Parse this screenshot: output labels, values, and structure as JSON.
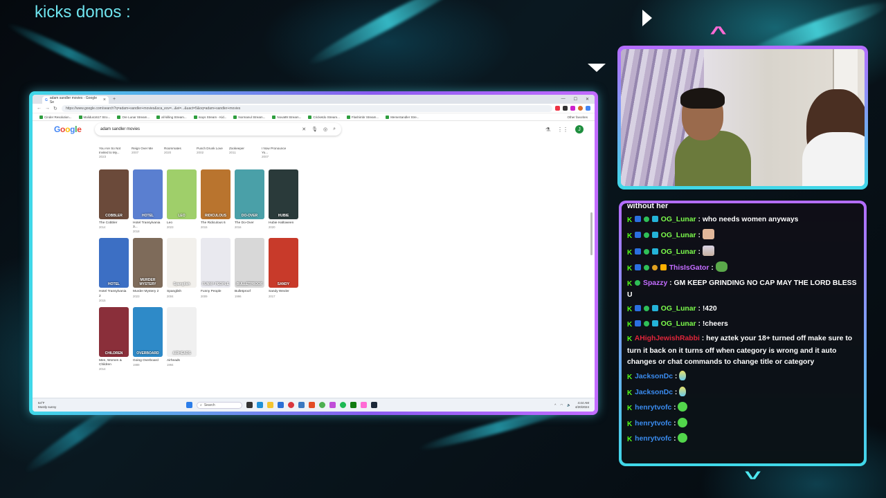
{
  "overlay": {
    "title": "kicks donos :"
  },
  "browser": {
    "tab_title": "adam sandler movies - Google Se",
    "url": "https://www.google.com/search?q=adam+sandler+movies&sca_esv=...&ei=...&uact=5&oq=adam+sandler+movies",
    "bookmarks": [
      "Cinder Resolution...",
      "Malidus1617 Stro...",
      "Ore Lunar Stream...",
      "all killing Stream...",
      "mays Stream - Kid...",
      "Normanul Stream...",
      "Nova89 Stream...",
      "Cricketdo Stream...",
      "Flashimbr Stream...",
      "MemeSandler Stre..."
    ],
    "bookmarks_right": "Other favorites",
    "search_query": "adam sandler movies",
    "avatar_letter": "J",
    "previous_row": [
      {
        "title": "You Are So Not Invited to My...",
        "year": "2023"
      },
      {
        "title": "Reign Over Me",
        "year": "2007"
      },
      {
        "title": "Roommates",
        "year": "2020"
      },
      {
        "title": "Punch Drunk Love",
        "year": "2002"
      },
      {
        "title": "Zookeeper",
        "year": "2011"
      },
      {
        "title": "I Now Pronounce Yo...",
        "year": "2007"
      }
    ],
    "movie_rows": [
      [
        {
          "title": "The Cobbler",
          "year": "2014",
          "poster_text": "COBBLER",
          "color": "#6b4a3a"
        },
        {
          "title": "Hotel Transylvania 3...",
          "year": "2018",
          "poster_text": "HOTEL",
          "color": "#5a7fd0"
        },
        {
          "title": "Leo",
          "year": "2023",
          "poster_text": "LEO",
          "color": "#9fcf6a"
        },
        {
          "title": "The Ridiculous 6",
          "year": "2015",
          "poster_text": "RIDICULOUS",
          "color": "#b9742e"
        },
        {
          "title": "The Do-Over",
          "year": "2016",
          "poster_text": "DO-OVER",
          "color": "#4aa0a8"
        },
        {
          "title": "Hubie Halloween",
          "year": "2020",
          "poster_text": "HUBIE",
          "color": "#2a3a3a"
        }
      ],
      [
        {
          "title": "Hotel Transylvania 2",
          "year": "2015",
          "poster_text": "HOTEL",
          "color": "#3c6fc4"
        },
        {
          "title": "Murder Mystery 2",
          "year": "2023",
          "poster_text": "MURDER MYSTERY",
          "color": "#7e6b5a"
        },
        {
          "title": "Spanglish",
          "year": "2004",
          "poster_text": "Spanglish",
          "color": "#f2f0ec"
        },
        {
          "title": "Funny People",
          "year": "2009",
          "poster_text": "FUNNY PEOPLE",
          "color": "#e9e9ef"
        },
        {
          "title": "Bulletproof",
          "year": "1996",
          "poster_text": "BULLETPROOF",
          "color": "#d8d8d8"
        },
        {
          "title": "Sandy Wexler",
          "year": "2017",
          "poster_text": "SANDY",
          "color": "#c83a2a"
        }
      ],
      [
        {
          "title": "Men, Women & Children",
          "year": "2014",
          "poster_text": "CHILDREN",
          "color": "#8a2f3a"
        },
        {
          "title": "Going Overboard",
          "year": "1989",
          "poster_text": "OVERBOARD",
          "color": "#2e8ac8"
        },
        {
          "title": "Airheads",
          "year": "1994",
          "poster_text": "AIRHEADS",
          "color": "#f0f0f0"
        }
      ]
    ],
    "taskbar": {
      "weather_temp": "64°F",
      "weather_desc": "Mostly sunny",
      "search_label": "Search",
      "time": "4:44 AM",
      "date": "4/20/2024"
    }
  },
  "chat": {
    "truncated_top": "without her",
    "messages": [
      {
        "user": "OG_Lunar",
        "color": "#7cfc4c",
        "text": "who needs women anyways",
        "emote": ""
      },
      {
        "user": "OG_Lunar",
        "color": "#7cfc4c",
        "text": "",
        "emote": "skin"
      },
      {
        "user": "OG_Lunar",
        "color": "#7cfc4c",
        "text": "",
        "emote": "face"
      },
      {
        "user": "ThisIsGator",
        "color": "#c36cff",
        "text": "",
        "emote": "croc"
      },
      {
        "user": "Spazzy",
        "color": "#c36cff",
        "text": "GM KEEP GRINDING NO CAP MAY THE LORD BLESS U",
        "emote": ""
      },
      {
        "user": "OG_Lunar",
        "color": "#7cfc4c",
        "text": "!420",
        "emote": ""
      },
      {
        "user": "OG_Lunar",
        "color": "#7cfc4c",
        "text": "!cheers",
        "emote": ""
      },
      {
        "user": "AHighJewishRabbi",
        "color": "#e0243a",
        "text": "hey aztek your 18+ turned off make sure to turn it back on it turns off when category is wrong and it auto changes or chat commands to change title or category",
        "emote": ""
      },
      {
        "user": "JacksonDc",
        "color": "#3a8cf0",
        "text": "",
        "emote": "balloon"
      },
      {
        "user": "JacksonDc",
        "color": "#3a8cf0",
        "text": "",
        "emote": "balloon"
      },
      {
        "user": "henrytvofc",
        "color": "#3a8cf0",
        "text": "",
        "emote": "green"
      },
      {
        "user": "henrytvofc",
        "color": "#3a8cf0",
        "text": "",
        "emote": "green"
      },
      {
        "user": "henrytvofc",
        "color": "#3a8cf0",
        "text": "",
        "emote": "green"
      }
    ]
  }
}
